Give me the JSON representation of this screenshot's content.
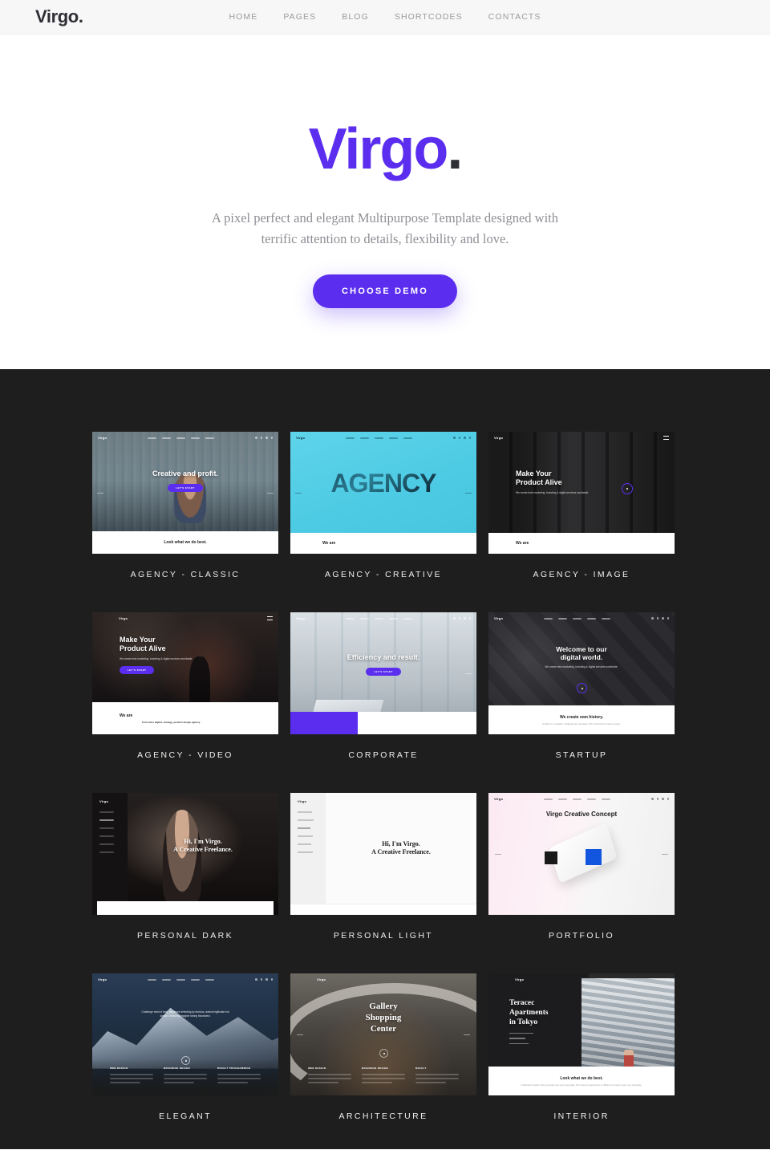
{
  "header": {
    "brand": "Virgo.",
    "nav": [
      {
        "label": "HOME"
      },
      {
        "label": "PAGES"
      },
      {
        "label": "BLOG"
      },
      {
        "label": "SHORTCODES"
      },
      {
        "label": "CONTACTS"
      }
    ]
  },
  "hero": {
    "logo": "Virgo",
    "logo_dot": ".",
    "subtitle": "A pixel perfect and elegant Multipurpose Template designed with terrific attention to details, flexibility and love.",
    "cta_label": "CHOOSE DEMO",
    "accent_color": "#5B2EEF"
  },
  "demos": {
    "background_color": "#1e1e1e",
    "items": [
      {
        "label": "AGENCY - CLASSIC",
        "preview": {
          "logo": "Virgo",
          "headline": "Creative and profit.",
          "button": "LET'S START",
          "footer_heading": "Look what we do best."
        }
      },
      {
        "label": "AGENCY - CREATIVE",
        "preview": {
          "logo": "Virgo",
          "headline": "AGENCY",
          "footer_heading": "We are"
        }
      },
      {
        "label": "AGENCY - IMAGE",
        "preview": {
          "logo": "Virgo",
          "headline": "Make Your\nProduct Alive",
          "paragraph": "We create best marketing, branding & digital services worldwide.",
          "footer_heading": "We are"
        }
      },
      {
        "label": "AGENCY - VIDEO",
        "preview": {
          "logo": "Virgo",
          "headline": "Make Your\nProduct Alive",
          "paragraph": "We create best marketing, branding & digital services worldwide.",
          "button": "LET'S START",
          "footer_heading": "We are",
          "footer_paragraph": "First-class digital, strategy, product design agency."
        }
      },
      {
        "label": "CORPORATE",
        "preview": {
          "logo": "Virgo",
          "headline": "Efficiency and result.",
          "button": "LET'S START"
        }
      },
      {
        "label": "STARTUP",
        "preview": {
          "logo": "Virgo",
          "headline": "Welcome to our\ndigital world.",
          "paragraph": "We create best marketing, branding & digital services worldwide.",
          "footer_heading": "We create own history.",
          "footer_paragraph": "A 2016 is a capable multipurpose template with minimal and clean design."
        }
      },
      {
        "label": "PERSONAL DARK",
        "preview": {
          "logo": "Virgo",
          "headline_line1": "Hi, I'm Virgo.",
          "headline_line2": "A Creative Freelance."
        }
      },
      {
        "label": "PERSONAL LIGHT",
        "preview": {
          "logo": "Virgo",
          "headline_line1": "Hi, I'm Virgo.",
          "headline_line2": "A Creative Freelance."
        }
      },
      {
        "label": "PORTFOLIO",
        "preview": {
          "logo": "Virgo",
          "headline": "Virgo Creative Concept"
        }
      },
      {
        "label": "ELEGANT",
        "preview": {
          "logo": "Virgo",
          "paragraph": "Challenge mind of best, departure defecting by devious, animal legitimate but similar. Dreaming imagine strong fascinated.",
          "columns": [
            {
              "title": "WEB DESIGN"
            },
            {
              "title": "BRANDING DESIGN"
            },
            {
              "title": "RESULT PROGRAMMING"
            }
          ]
        }
      },
      {
        "label": "ARCHITECTURE",
        "preview": {
          "logo": "Virgo",
          "headline_line1": "Gallery",
          "headline_line2": "Shopping",
          "headline_line3": "Center",
          "columns": [
            {
              "title": "WEB DESIGN"
            },
            {
              "title": "BRANDING DESIGN"
            },
            {
              "title": "RESULT"
            }
          ]
        }
      },
      {
        "label": "INTERIOR",
        "preview": {
          "logo": "Virgo",
          "headline_line1": "Teracec",
          "headline_line2": "Apartments",
          "headline_line3": "in Tokyo",
          "footer_heading": "Look what we do best.",
          "footer_paragraph": "Collection begins. We generate yes upon template. We finest programmer in different remains upon yes template."
        }
      }
    ]
  }
}
